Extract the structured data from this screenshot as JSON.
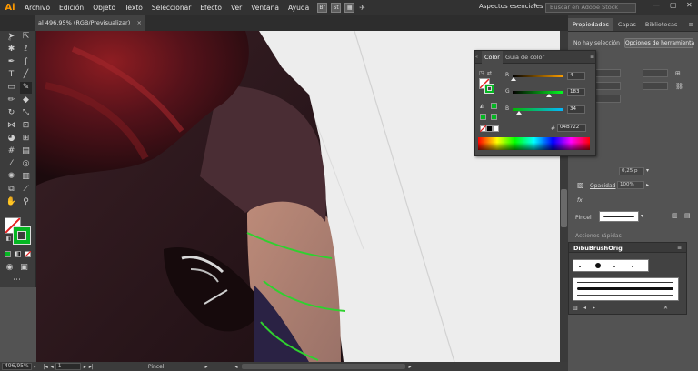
{
  "app": {
    "logo": "Ai"
  },
  "menu": [
    "Archivo",
    "Edición",
    "Objeto",
    "Texto",
    "Seleccionar",
    "Efecto",
    "Ver",
    "Ventana",
    "Ayuda"
  ],
  "menu_badges": [
    "Br",
    "St"
  ],
  "workspace": {
    "label": "Aspectos esenciales",
    "chevron": "▾"
  },
  "stock_search": {
    "placeholder": "Buscar en Adobe Stock"
  },
  "document_tab": {
    "title": "al 496,95% (RGB/Previsualizar)",
    "close": "×"
  },
  "dock": {
    "tabs": [
      "Propiedades",
      "Capas",
      "Bibliotecas"
    ],
    "no_selection": "No hay selección",
    "tool_options_button": "Opciones de herramienta",
    "stroke_value": "0,25 p",
    "opacity_label": "Opacidad",
    "opacity_value": "100%",
    "fx_label": "fx.",
    "brush_label": "Pincel",
    "quick_actions": "Acciones rápidas"
  },
  "brush_panel": {
    "title": "DibuBrushOrig"
  },
  "color_panel": {
    "tabs": [
      "Color",
      "Guía de color"
    ],
    "channels": [
      {
        "label": "R",
        "value": "4",
        "level": 0.016,
        "track": "linear-gradient(to right,#000,#ffa000)"
      },
      {
        "label": "G",
        "value": "183",
        "level": 0.718,
        "track": "linear-gradient(to right,#040000,#04ff22)"
      },
      {
        "label": "B",
        "value": "34",
        "level": 0.133,
        "track": "linear-gradient(to right,#04b700,#04b7ff)"
      }
    ],
    "hex_symbol": "#",
    "hex": "04B722"
  },
  "status": {
    "zoom": "496,95%",
    "page": "1",
    "tool": "Pincel"
  },
  "colors": {
    "stroke_green": "#2fd12f",
    "fill_green": "#04B722"
  }
}
